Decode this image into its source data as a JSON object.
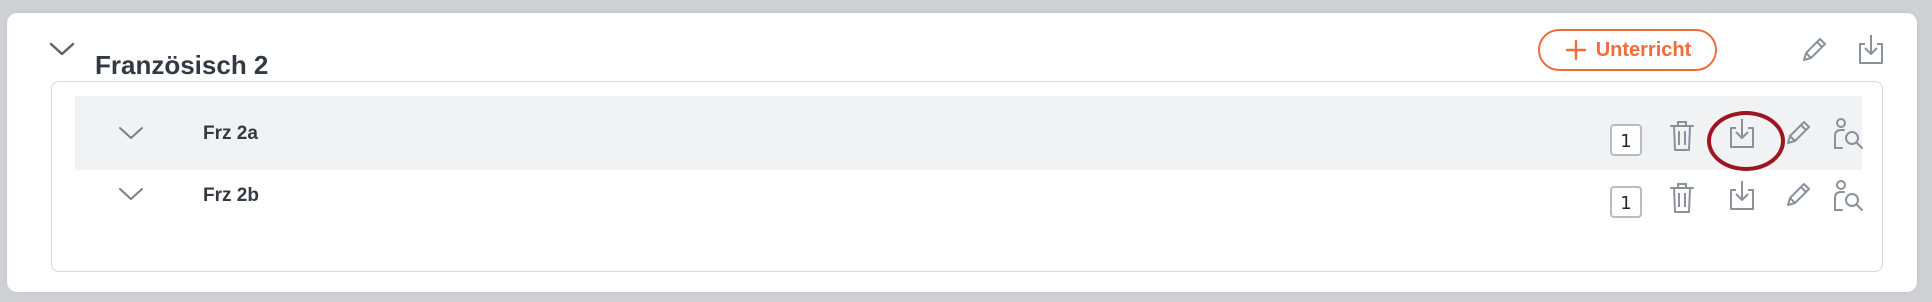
{
  "group": {
    "title": "Französisch 2",
    "add_button_label": "Unterricht"
  },
  "rows": [
    {
      "label": "Frz 2a",
      "count": "1"
    },
    {
      "label": "Frz 2b",
      "count": "1"
    }
  ],
  "colors": {
    "accent": "#f06c3a",
    "highlight": "#9c1520",
    "row_highlight_bg": "#f1f2f4",
    "icon": "#8a919b"
  }
}
